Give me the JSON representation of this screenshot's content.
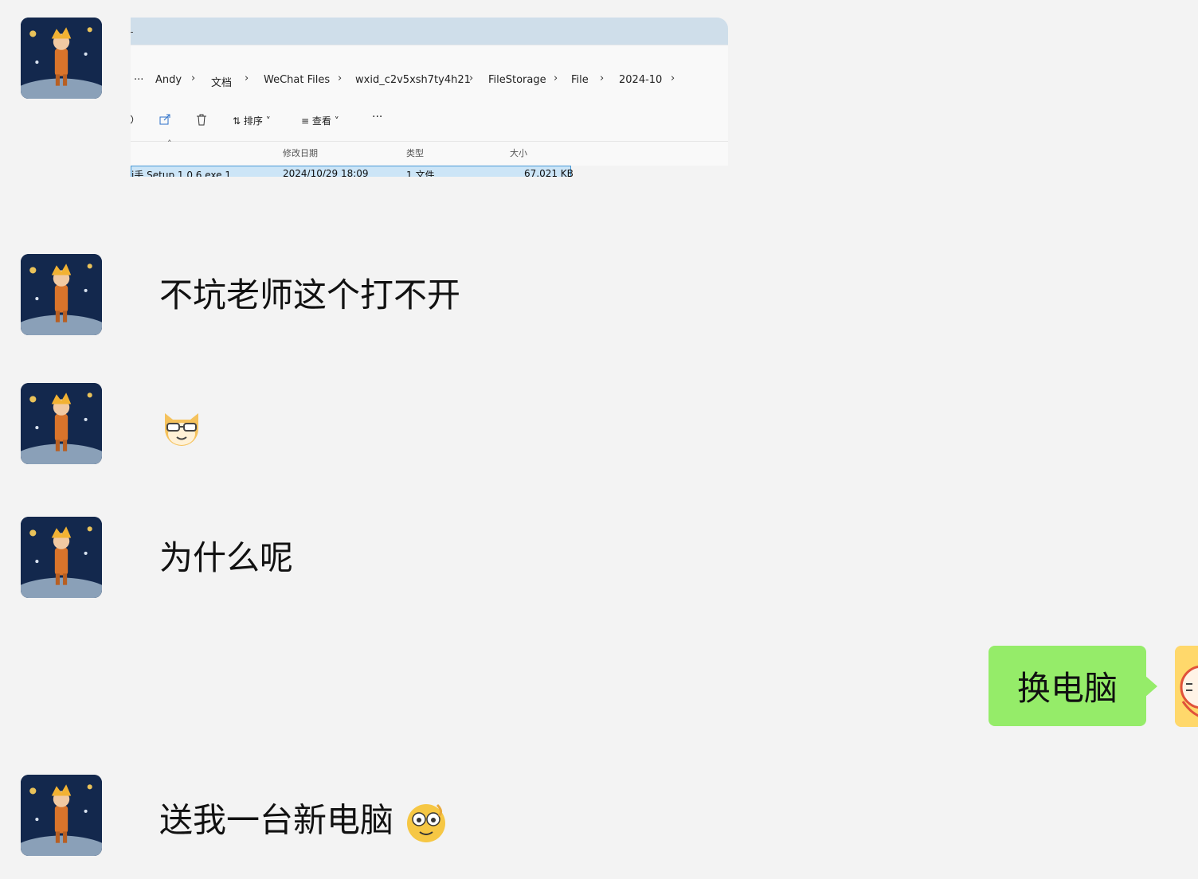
{
  "screenshot": {
    "breadcrumb": [
      "Andy",
      "文档",
      "WeChat Files",
      "wxid_c2v5xsh7ty4h21",
      "FileStorage",
      "File",
      "2024-10"
    ],
    "toolbar": {
      "sort": "排序",
      "view": "查看",
      "more": "···"
    },
    "columns": {
      "modified": "修改日期",
      "type": "类型",
      "size": "大小"
    },
    "file": {
      "name": "j手 Setup 1.0.6.exe.1",
      "modified": "2024/10/29 18:09",
      "type": "1 文件",
      "size": "67,021 KB"
    }
  },
  "messages": [
    {
      "from": "them",
      "text": "不坑老师这个打不开"
    },
    {
      "from": "them",
      "emoji": "cat-glasses-emoji"
    },
    {
      "from": "them",
      "text": "为什么呢"
    },
    {
      "from": "me",
      "text": "换电脑"
    },
    {
      "from": "them",
      "text": "送我一台新电脑",
      "emoji": "drool-emoji"
    }
  ],
  "colors": {
    "background": "#f3f3f3",
    "outgoing_bubble": "#95ec69",
    "selection": "#cce5f7"
  }
}
